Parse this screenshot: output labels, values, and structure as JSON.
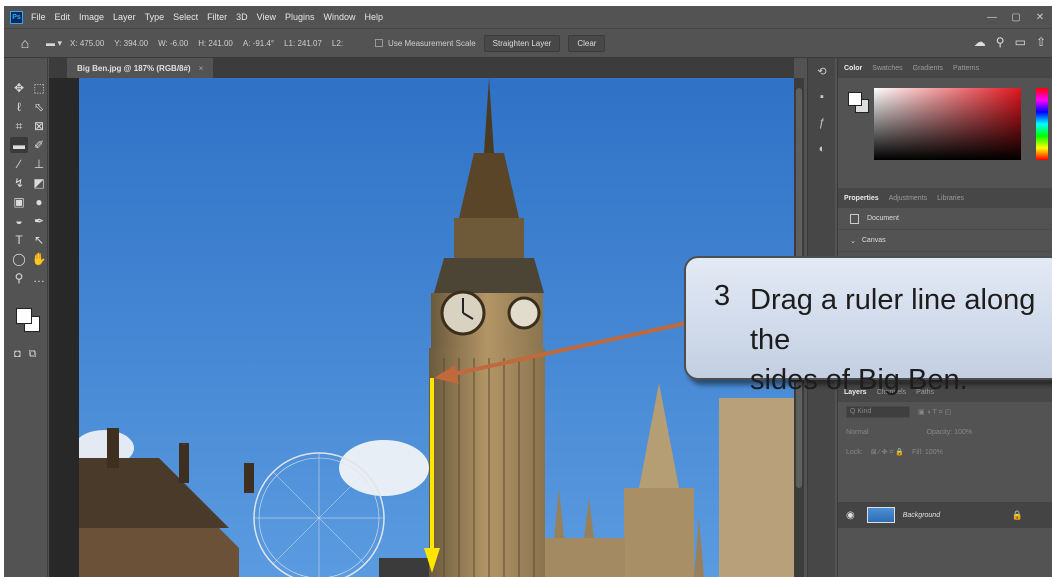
{
  "app": {
    "logo_label": "Ps"
  },
  "menu": [
    "File",
    "Edit",
    "Image",
    "Layer",
    "Type",
    "Select",
    "Filter",
    "3D",
    "View",
    "Plugins",
    "Window",
    "Help"
  ],
  "window_controls": [
    "—",
    "▢",
    "✕"
  ],
  "options_bar": {
    "x": "X: 475.00",
    "y": "Y: 394.00",
    "w": "W: -6.00",
    "h": "H: 241.00",
    "a": "A: -91.4°",
    "l1": "L1: 241.07",
    "l2": "L2:",
    "measurement_scale_label": "Use Measurement Scale",
    "straighten_label": "Straighten Layer",
    "clear_label": "Clear"
  },
  "document": {
    "tab_title": "Big Ben.jpg @ 187% (RGB/8#)",
    "tab_close": "×"
  },
  "panels": {
    "color_tabs": [
      "Color",
      "Swatches",
      "Gradients",
      "Patterns"
    ],
    "properties_tabs": [
      "Properties",
      "Adjustments",
      "Libraries"
    ],
    "document_label": "Document",
    "canvas_label": "Canvas",
    "layers_tabs": [
      "Layers",
      "Channels",
      "Paths"
    ],
    "kind_placeholder": "Q Kind",
    "blend_mode": "Normal",
    "opacity_label": "Opacity: 100%",
    "lock_label": "Lock:",
    "fill_label": "Fill: 100%",
    "layer_name": "Background"
  },
  "callout": {
    "number": "3",
    "text": "Drag a ruler line along the\nsides of Big Ben."
  },
  "colors": {
    "sky": "#3d82d1",
    "arrow_yellow": "#ffe600",
    "arrow_orange": "#c1693a"
  }
}
